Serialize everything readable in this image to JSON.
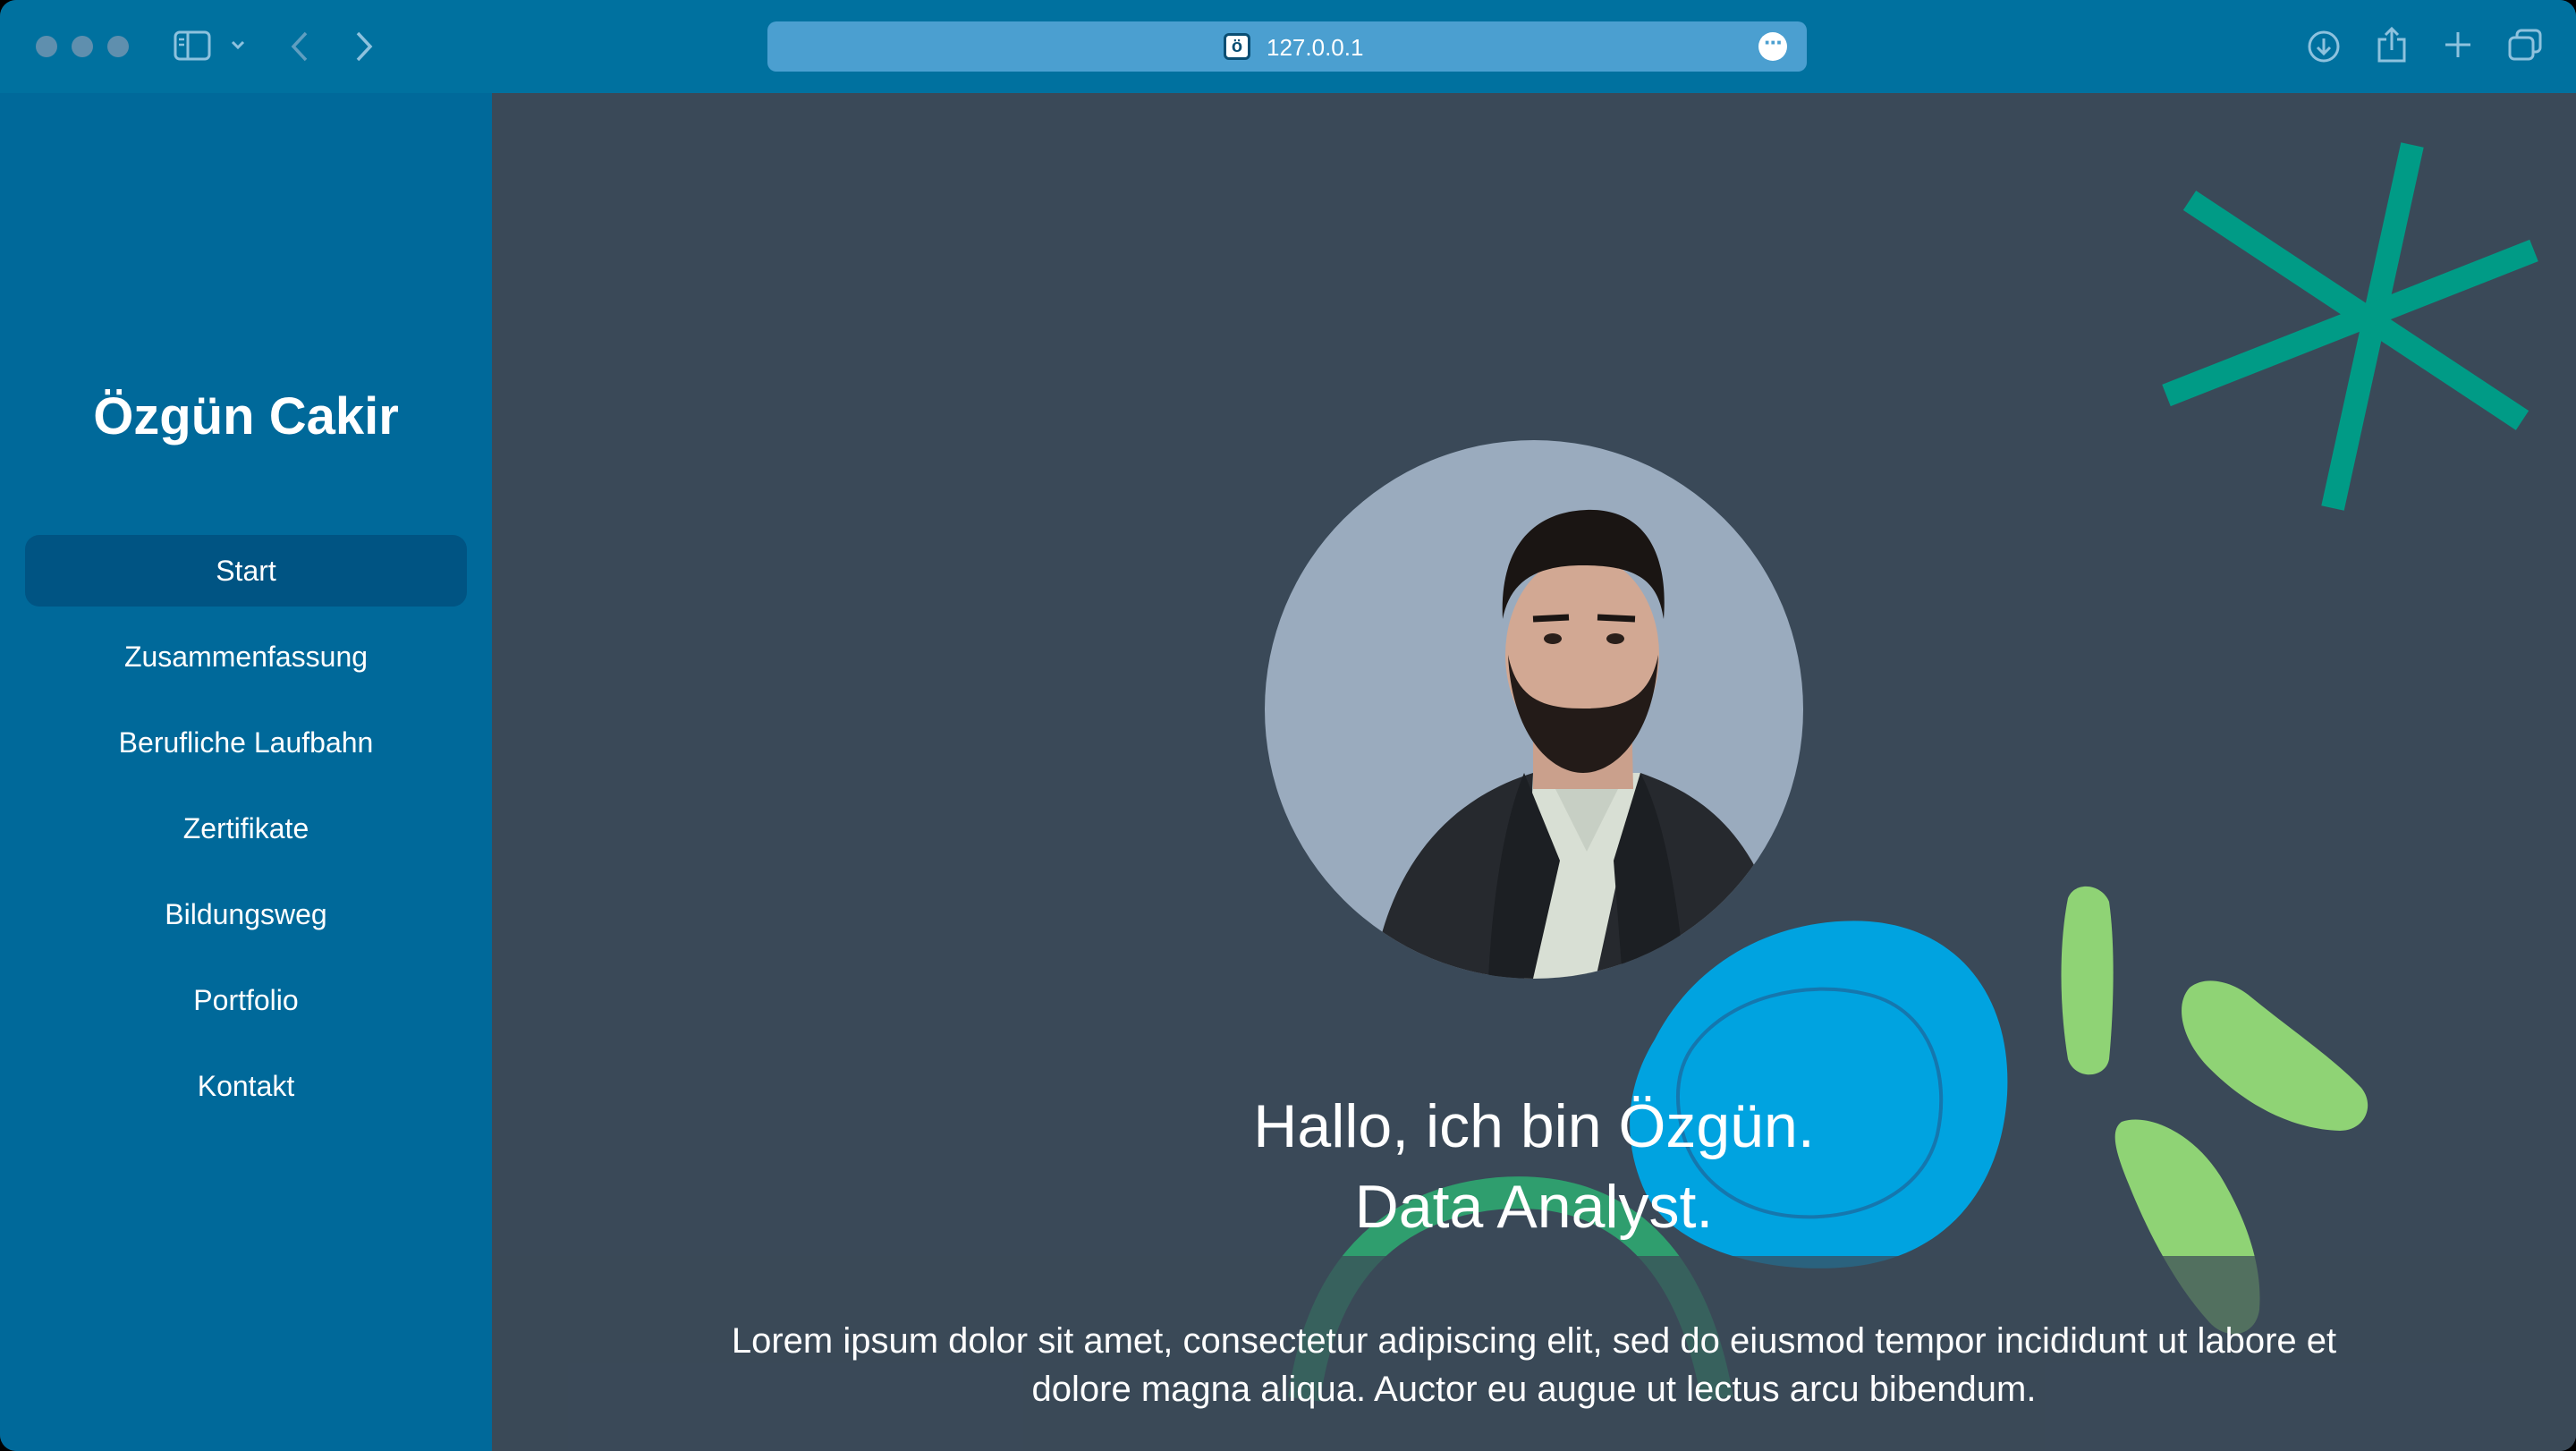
{
  "browser": {
    "url": "127.0.0.1",
    "favicon_glyph": "ö",
    "icons": {
      "sidebar_toggle": "sidebar-icon",
      "back": "chevron-left-icon",
      "forward": "chevron-right-icon",
      "download": "download-icon",
      "share": "share-icon",
      "new_tab": "plus-icon",
      "tabs": "tabs-overview-icon",
      "page_menu": "more-icon"
    },
    "colors": {
      "toolbar": "#00719f",
      "urlbar": "#4b9fd0"
    }
  },
  "sidebar": {
    "title": "Özgün Cakir",
    "items": [
      {
        "label": "Start",
        "active": true
      },
      {
        "label": "Zusammenfassung",
        "active": false
      },
      {
        "label": "Berufliche Laufbahn",
        "active": false
      },
      {
        "label": "Zertifikate",
        "active": false
      },
      {
        "label": "Bildungsweg",
        "active": false
      },
      {
        "label": "Portfolio",
        "active": false
      },
      {
        "label": "Kontakt",
        "active": false
      }
    ],
    "colors": {
      "background": "#00699a",
      "active_item": "#005483"
    }
  },
  "hero": {
    "title_line1": "Hallo, ich bin Özgün.",
    "title_line2": "Data Analyst.",
    "text": "Lorem ipsum dolor sit amet, consectetur adipiscing elit, sed do eiusmod tempor incididunt ut labore et dolore magna aliqua. Auctor eu augue ut lectus arcu bibendum.",
    "colors": {
      "background": "#3a4958",
      "asterisk": "#009b86",
      "blob": "#00a3e0",
      "leaves": "#8fd375",
      "arc": "#2f9e6e"
    }
  }
}
